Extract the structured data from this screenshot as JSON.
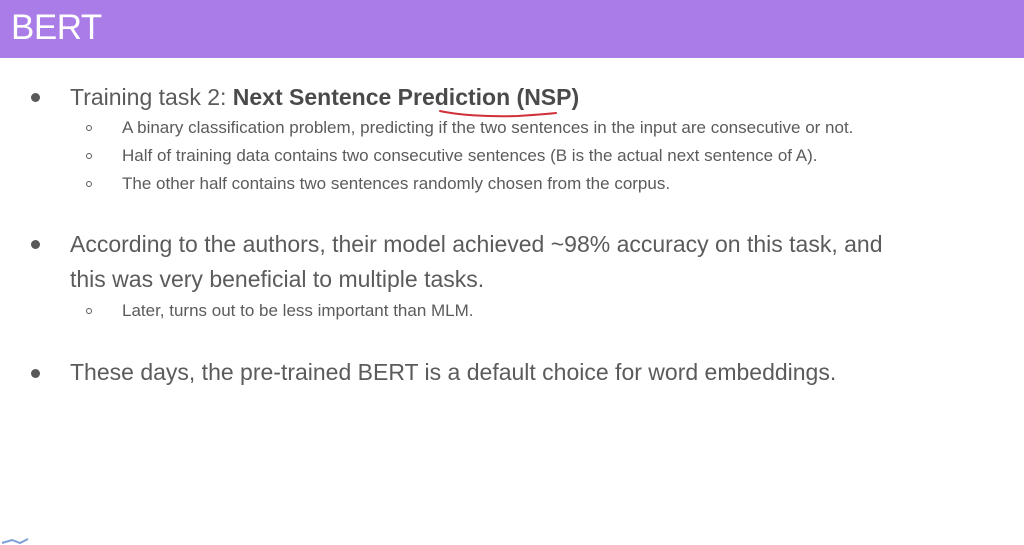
{
  "slide": {
    "title": "BERT",
    "bullet1": {
      "prefix": "Training task 2: ",
      "bold": "Next Sentence Prediction (NSP)",
      "subs": [
        "A binary classification problem, predicting if the two sentences in the input are consecutive or not.",
        "Half of training data contains two consecutive sentences (B is the actual next sentence of A).",
        "The other half contains two sentences randomly chosen from the corpus."
      ]
    },
    "bullet2": {
      "line1": "According to the authors, their model achieved ~98% accuracy on this task, and",
      "line2": "this was very beneficial to multiple tasks.",
      "subs": [
        "Later, turns out to be less important than MLM."
      ]
    },
    "bullet3": {
      "text": "These days, the pre-trained BERT is a default choice for word embeddings."
    }
  },
  "colors": {
    "title_bar": "#a97ce8",
    "text": "#5b5b5b",
    "annotation": "#d0303a"
  }
}
